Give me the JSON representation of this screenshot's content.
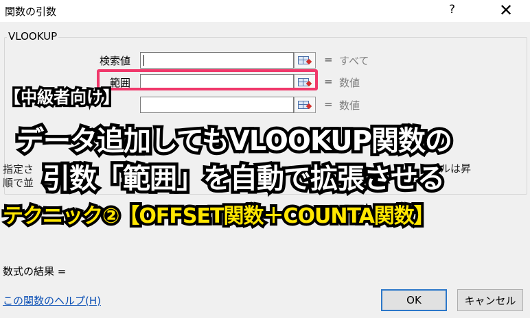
{
  "dialog": {
    "title": "関数の引数",
    "help_glyph": "?",
    "close_glyph": "✕"
  },
  "function_group": {
    "name": "VLOOKUP",
    "args": [
      {
        "label": "検索値",
        "value": "",
        "type": "すべて"
      },
      {
        "label": "範囲",
        "value": "",
        "type": "数値"
      },
      {
        "label": "",
        "value": "",
        "type": "数値"
      }
    ],
    "equals": "="
  },
  "description": {
    "line1": "指定さ",
    "line2": "順で並",
    "right": "ブルは昇"
  },
  "formula_result_label": "数式の結果 =",
  "help_link": "この関数のヘルプ(H)",
  "buttons": {
    "ok": "OK",
    "cancel": "キャンセル"
  },
  "overlay": {
    "tag": "【中級者向け】",
    "line1": "データ追加してもVLOOKUP関数の",
    "line2": "引数「範囲」を自動で拡張させる",
    "line3": "テクニック②【OFFSET関数＋COUNTA関数】"
  },
  "colors": {
    "highlight": "#f0386b",
    "overlay_yellow": "#ffe600",
    "link": "#0a4fb5",
    "ok_border": "#2b77c9"
  }
}
